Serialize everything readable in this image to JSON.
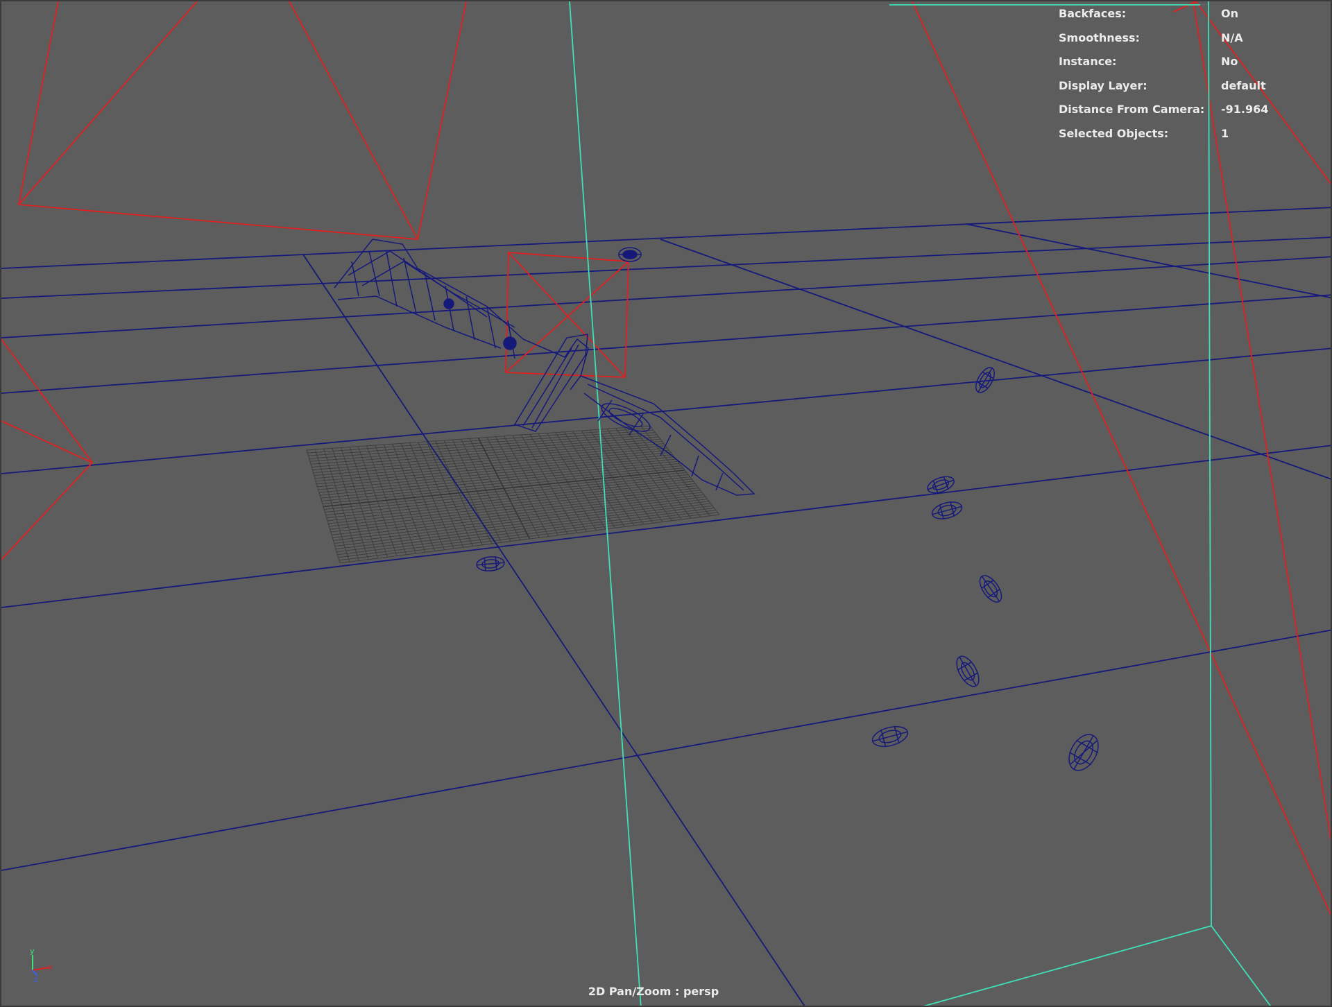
{
  "hud": {
    "rows": [
      {
        "label": "Backfaces:",
        "value": "On"
      },
      {
        "label": "Smoothness:",
        "value": "N/A"
      },
      {
        "label": "Instance:",
        "value": "No"
      },
      {
        "label": "Display Layer:",
        "value": "default"
      },
      {
        "label": "Distance From Camera:",
        "value": "-91.964"
      },
      {
        "label": "Selected Objects:",
        "value": "1"
      }
    ]
  },
  "camera": {
    "label": "2D Pan/Zoom : persp"
  },
  "axis_gizmo": {
    "y_label": "y",
    "x_label": "x",
    "z_label": "z"
  },
  "colors": {
    "background": "#5d5d5d",
    "wire_blue": "#15197a",
    "selection_red": "#e02020",
    "camera_cyan": "#3fe0b8",
    "grid": "#3e3e3e",
    "hud_text": "#ececec"
  },
  "scene_objects": [
    "knife-wireframe",
    "ground-grid",
    "camera-frustums",
    "light-boxes",
    "small-wireframe-objects"
  ]
}
